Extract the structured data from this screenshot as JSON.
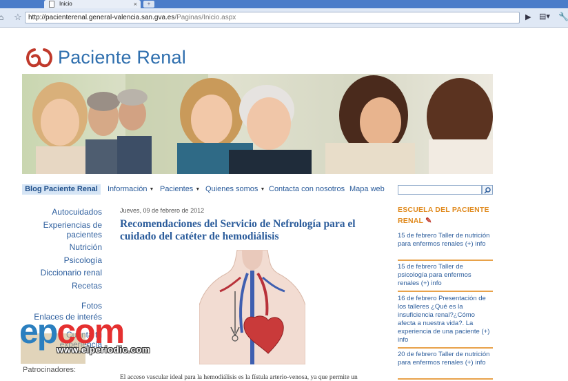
{
  "browser": {
    "tab_title": "Inicio",
    "tab_close": "×",
    "new_tab": "+",
    "url_prefix": "http://pacienterenal.general-valencia.san.gva.es",
    "url_path": "/Paginas/Inicio.aspx",
    "icons": [
      "home-icon",
      "star-icon",
      "go-icon",
      "page-icon",
      "wrench-icon"
    ]
  },
  "site": {
    "logo_text": "Paciente Renal",
    "brand_color": "#2f6fae",
    "accent_color": "#e08a1e"
  },
  "nav": {
    "active": "Blog Paciente Renal",
    "items": [
      {
        "label": "Información",
        "dropdown": true
      },
      {
        "label": "Pacientes",
        "dropdown": true
      },
      {
        "label": "Quienes somos",
        "dropdown": true
      },
      {
        "label": "Contacta con nosotros",
        "dropdown": false
      },
      {
        "label": "Mapa web",
        "dropdown": false
      }
    ],
    "search_value": ""
  },
  "left_nav": {
    "items": [
      "Autocuidados",
      "Experiencias de",
      "pacientes",
      "Nutrición",
      "Psicología",
      "Diccionario renal",
      "Recetas",
      "Fotos",
      "Enlaces de interés",
      "Cuenta tu",
      "experiencia"
    ]
  },
  "article": {
    "date": "Jueves, 09 de febrero de 2012",
    "title": "Recomendaciones del Servicio de Nefrología para el cuidado del catéter de hemodiálisis",
    "body_start": "El acceso vascular ideal para la hemodiálisis es la fístula arterio-venosa, ya que permite un"
  },
  "sidebar": {
    "title_line1": "ESCUELA DEL PACIENTE",
    "title_line2": "RENAL",
    "events": [
      "15 de febrero Taller de nutrición para enfermos renales (+) info",
      "15 de febrero Taller de psicología para enfermos renales (+) info",
      "16 de febrero Presentación de los talleres ¿Qué es la insuficiencia renal?¿Cómo afecta a nuestra vida?. La experiencia de una paciente (+) info",
      "20 de febrero Taller de nutrición para enfermos renales (+) info"
    ]
  },
  "footer": {
    "sponsors_label": "Patrocinadores:"
  },
  "watermark": {
    "logo_e": "ep",
    "logo_rest": "com",
    "site": "www.elperiodic.com"
  }
}
